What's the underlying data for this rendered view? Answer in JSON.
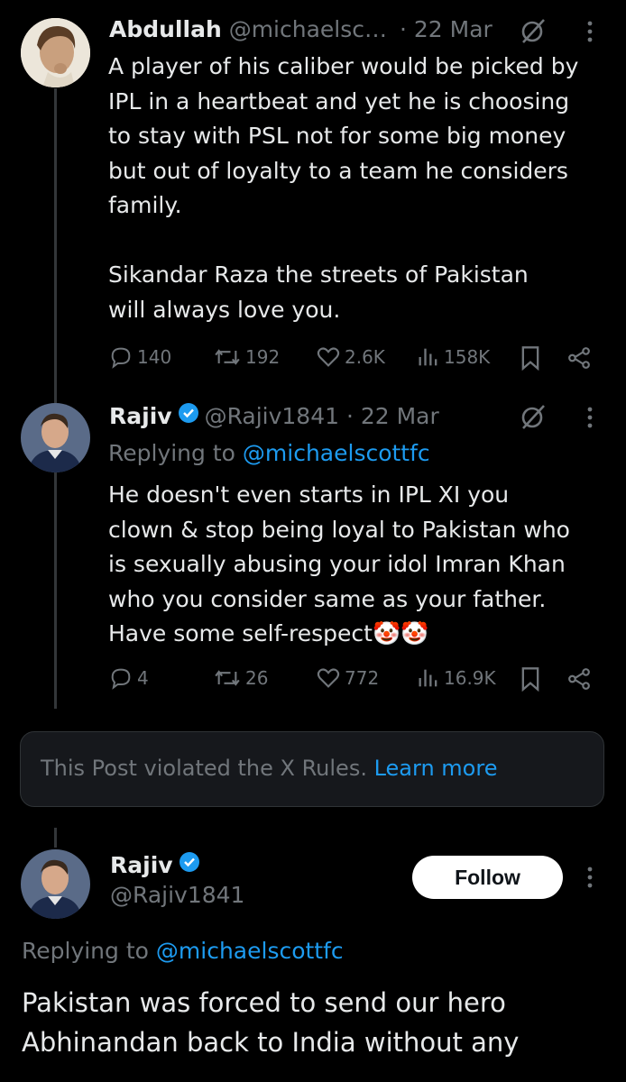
{
  "colors": {
    "background": "#000000",
    "text": "#e7e9ea",
    "muted": "#71767b",
    "link": "#1d9bf0",
    "verified": "#1d9bf0"
  },
  "tweet1": {
    "name": "Abdullah",
    "handle": "@michaelsc…",
    "date": "· 22 Mar",
    "body": "A player of his caliber would be picked by\nIPL in a heartbeat and yet he is choosing\nto stay with PSL not for some big money\nbut out of loyalty to a team he considers\nfamily.\n\nSikandar Raza the streets of Pakistan\nwill always love you.",
    "replies": "140",
    "retweets": "192",
    "likes": "2.6K",
    "views": "158K"
  },
  "tweet2": {
    "name": "Rajiv",
    "handle": "@Rajiv1841 · 22 Mar",
    "replying_label": "Replying to",
    "replying_handle": "@michaelscottfc",
    "body": "He doesn't even starts in IPL XI you\nclown & stop being loyal to Pakistan who\nis sexually abusing your idol Imran Khan\nwho you consider same as your father.\nHave some self-respect🤡🤡",
    "replies": "4",
    "retweets": "26",
    "likes": "772",
    "views": "16.9K"
  },
  "violation": {
    "text": "This Post violated the X Rules.",
    "link": "Learn more"
  },
  "tweet3": {
    "name": "Rajiv",
    "handle": "@Rajiv1841",
    "follow_label": "Follow",
    "replying_label": "Replying to",
    "replying_handle": "@michaelscottfc",
    "body": "Pakistan was forced to send our hero\nAbhinandan back to India without any"
  },
  "icons": [
    "reply-icon",
    "retweet-icon",
    "like-icon",
    "views-icon",
    "bookmark-icon",
    "share-icon",
    "grok-icon",
    "more-icon",
    "verified-icon"
  ]
}
